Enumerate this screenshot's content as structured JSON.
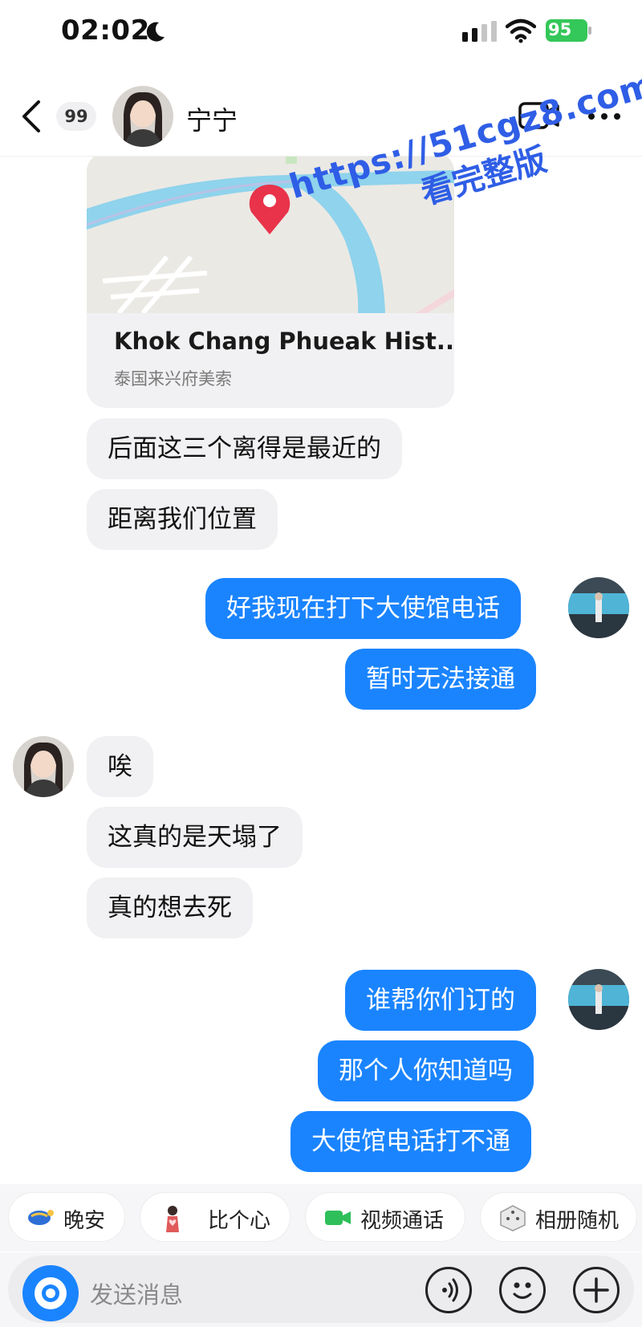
{
  "status_bar": {
    "time": "02:02",
    "battery": "95"
  },
  "header": {
    "unread_count": "99",
    "contact_name": "宁宁"
  },
  "location_card": {
    "title": "Khok Chang Phueak Hist...",
    "subtitle": "泰国来兴府美索"
  },
  "messages": [
    {
      "side": "in",
      "text": "后面这三个离得是最近的"
    },
    {
      "side": "in",
      "text": "距离我们位置"
    },
    {
      "side": "out",
      "text": "好我现在打下大使馆电话"
    },
    {
      "side": "out",
      "text": "暂时无法接通"
    },
    {
      "side": "in",
      "text": "唉"
    },
    {
      "side": "in",
      "text": "这真的是天塌了"
    },
    {
      "side": "in",
      "text": "真的想去死"
    },
    {
      "side": "out",
      "text": "谁帮你们订的"
    },
    {
      "side": "out",
      "text": "那个人你知道吗"
    },
    {
      "side": "out",
      "text": "大使馆电话打不通"
    }
  ],
  "watermark": {
    "url": "https://51cgz8.com",
    "subtitle": "看完整版"
  },
  "quick_replies": [
    {
      "label": "晚安",
      "icon": "moon-cake-icon"
    },
    {
      "label": "比个心",
      "icon": "heart-gesture-icon"
    },
    {
      "label": "视频通话",
      "icon": "video-camera-icon"
    },
    {
      "label": "相册随机",
      "icon": "dice-icon"
    }
  ],
  "input": {
    "placeholder": "发送消息"
  },
  "colors": {
    "accent": "#1a84ff",
    "incoming_bubble": "#f1f1f3",
    "battery": "#34c759",
    "watermark": "#2f5ee6",
    "map_water": "#8fd3ec",
    "map_land": "#ebe9e4",
    "map_pin": "#e8334a"
  }
}
